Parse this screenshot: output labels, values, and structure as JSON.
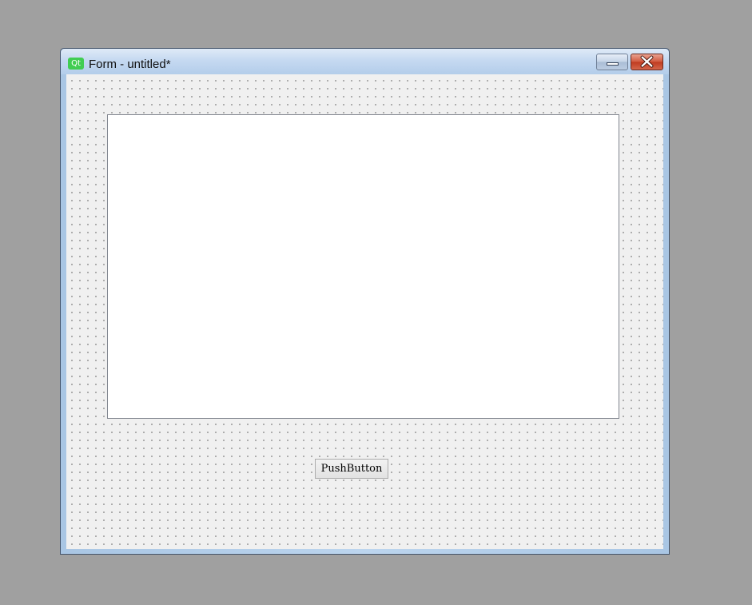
{
  "window": {
    "title": "Form - untitled*",
    "app_icon": "qt-logo-icon",
    "app_icon_text": "Qt",
    "accent": "#41cd52"
  },
  "titlebar_buttons": {
    "minimize_icon": "minimize-icon",
    "close_icon": "close-icon"
  },
  "form": {
    "push_button_label": "PushButton",
    "list_widget_items": []
  },
  "colors": {
    "desktop": "#a0a0a0",
    "form_background": "#f0f0f0",
    "close_button": "#c9452a"
  }
}
